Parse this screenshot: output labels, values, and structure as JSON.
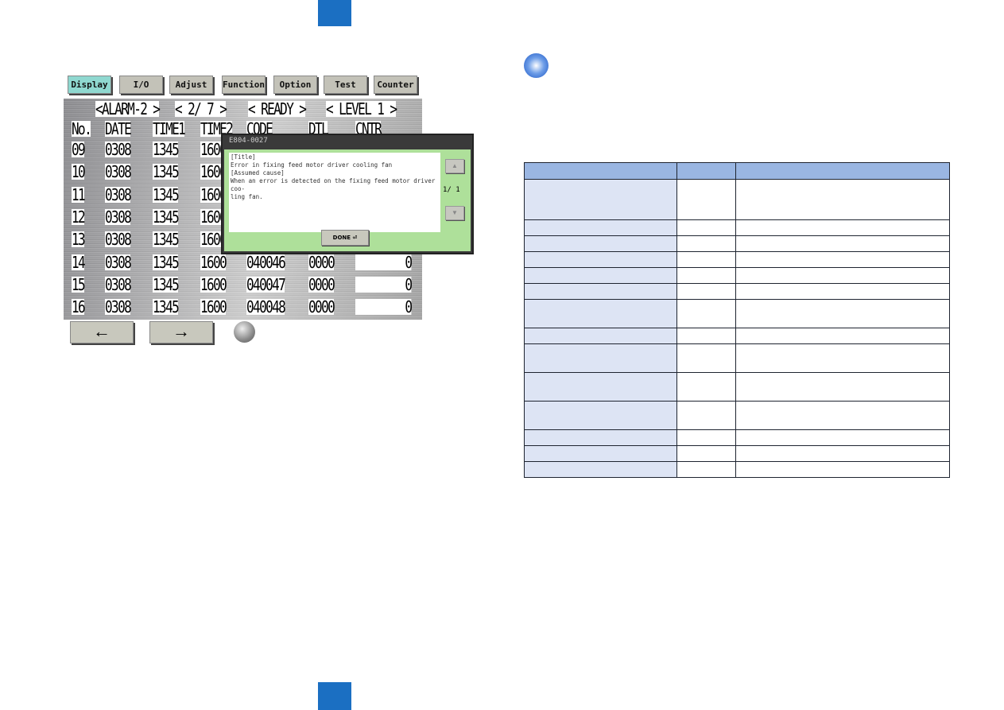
{
  "toolbar": {
    "buttons": [
      {
        "label": "Display",
        "active": true
      },
      {
        "label": "I/O"
      },
      {
        "label": "Adjust"
      },
      {
        "label": "Function"
      },
      {
        "label": "Option"
      },
      {
        "label": "Test"
      },
      {
        "label": "Counter"
      }
    ]
  },
  "status": {
    "mode": "<ALARM-2 >",
    "page": "<  2/ 7 >",
    "state": "< READY   >",
    "level": "< LEVEL 1 >"
  },
  "columns": [
    "No.",
    "DATE",
    "TIME1",
    "TIME2",
    "CODE",
    "DTL",
    "CNTR"
  ],
  "rows": [
    {
      "no": "09",
      "date": "0308",
      "time1": "1345",
      "time2": "1600",
      "code": "",
      "dtl": "",
      "cntr": ""
    },
    {
      "no": "10",
      "date": "0308",
      "time1": "1345",
      "time2": "1600",
      "code": "",
      "dtl": "",
      "cntr": ""
    },
    {
      "no": "11",
      "date": "0308",
      "time1": "1345",
      "time2": "1600",
      "code": "",
      "dtl": "",
      "cntr": ""
    },
    {
      "no": "12",
      "date": "0308",
      "time1": "1345",
      "time2": "1600",
      "code": "",
      "dtl": "",
      "cntr": ""
    },
    {
      "no": "13",
      "date": "0308",
      "time1": "1345",
      "time2": "1600",
      "code": "",
      "dtl": "",
      "cntr": ""
    },
    {
      "no": "14",
      "date": "0308",
      "time1": "1345",
      "time2": "1600",
      "code": "040046",
      "dtl": "0000",
      "cntr": "0"
    },
    {
      "no": "15",
      "date": "0308",
      "time1": "1345",
      "time2": "1600",
      "code": "040047",
      "dtl": "0000",
      "cntr": "0"
    },
    {
      "no": "16",
      "date": "0308",
      "time1": "1345",
      "time2": "1600",
      "code": "040048",
      "dtl": "0000",
      "cntr": "0"
    }
  ],
  "dialog": {
    "title": "E804-0027",
    "text": "[Title]\nError in fixing feed motor driver cooling fan\n[Assumed cause]\nWhen an error is detected on the fixing feed motor driver coo-\nling fan.",
    "page": "1/ 1",
    "done_label": "DONE ⏎",
    "up_icon": "triangle-up",
    "down_icon": "triangle-down"
  },
  "nav": {
    "prev": "←",
    "next": "→"
  },
  "colors": {
    "page_tab": "#1b6fc2",
    "table_header": "#9ab6e2",
    "table_first_col": "#dde4f4",
    "dialog_bg": "#aee09a",
    "active_tab": "#8fd8d0"
  }
}
